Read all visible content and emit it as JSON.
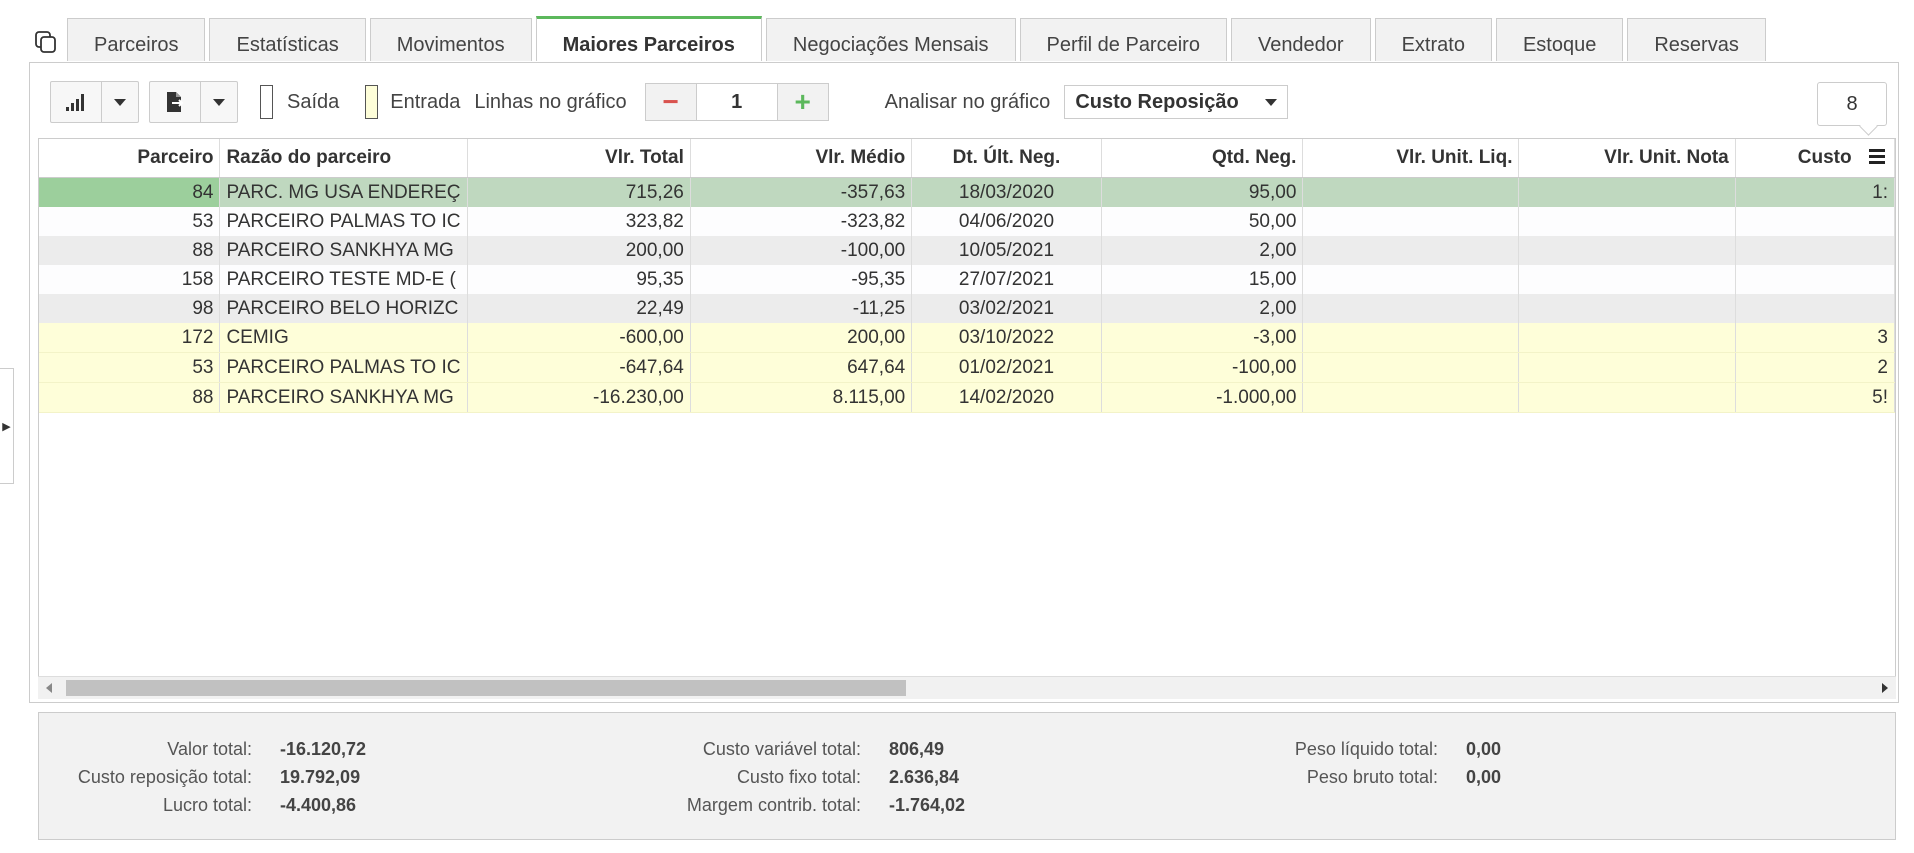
{
  "tabs": [
    "Parceiros",
    "Estatísticas",
    "Movimentos",
    "Maiores Parceiros",
    "Negociações Mensais",
    "Perfil de Parceiro",
    "Vendedor",
    "Extrato",
    "Estoque",
    "Reservas"
  ],
  "active_tab": "Maiores Parceiros",
  "toolbar": {
    "legend_saida": "Saída",
    "legend_entrada": "Entrada",
    "lines_label": "Linhas no gráfico",
    "lines_value": "1",
    "minus": "−",
    "plus": "+",
    "analyze_label": "Analisar no gráfico",
    "analyze_value": "Custo Reposição",
    "record_count": "8"
  },
  "colors": {
    "accent": "#5cb85c",
    "minus": "#d9534f",
    "selected_row": "#bfd8bf",
    "entrada_row": "#fefed9"
  },
  "table": {
    "columns": [
      "Parceiro",
      "Razão do parceiro",
      "Vlr. Total",
      "Vlr. Médio",
      "Dt. Últ. Neg.",
      "Qtd. Neg.",
      "Vlr. Unit. Liq.",
      "Vlr. Unit. Nota",
      "Custo"
    ],
    "rows": [
      {
        "type": "selected",
        "c": [
          "84",
          "PARC. MG USA ENDEREÇ",
          "715,26",
          "-357,63",
          "18/03/2020",
          "95,00",
          "",
          "",
          "1:"
        ]
      },
      {
        "type": "white",
        "c": [
          "53",
          "PARCEIRO PALMAS TO IC",
          "323,82",
          "-323,82",
          "04/06/2020",
          "50,00",
          "",
          "",
          ""
        ]
      },
      {
        "type": "gray",
        "c": [
          "88",
          "PARCEIRO SANKHYA MG",
          "200,00",
          "-100,00",
          "10/05/2021",
          "2,00",
          "",
          "",
          ""
        ]
      },
      {
        "type": "white",
        "c": [
          "158",
          "PARCEIRO TESTE MD-E (",
          "95,35",
          "-95,35",
          "27/07/2021",
          "15,00",
          "",
          "",
          ""
        ]
      },
      {
        "type": "gray",
        "c": [
          "98",
          "PARCEIRO BELO HORIZC",
          "22,49",
          "-11,25",
          "03/02/2021",
          "2,00",
          "",
          "",
          ""
        ]
      },
      {
        "type": "yellow",
        "c": [
          "172",
          "CEMIG",
          "-600,00",
          "200,00",
          "03/10/2022",
          "-3,00",
          "",
          "",
          "3"
        ]
      },
      {
        "type": "yellow",
        "c": [
          "53",
          "PARCEIRO PALMAS TO IC",
          "-647,64",
          "647,64",
          "01/02/2021",
          "-100,00",
          "",
          "",
          "2"
        ]
      },
      {
        "type": "yellow",
        "c": [
          "88",
          "PARCEIRO SANKHYA MG",
          "-16.230,00",
          "8.115,00",
          "14/02/2020",
          "-1.000,00",
          "",
          "",
          "5!"
        ]
      }
    ]
  },
  "totals": {
    "valor_total": {
      "k": "Valor total:",
      "v": "-16.120,72"
    },
    "custo_reposicao_total": {
      "k": "Custo reposição total:",
      "v": "19.792,09"
    },
    "lucro_total": {
      "k": "Lucro total:",
      "v": "-4.400,86"
    },
    "custo_variavel_total": {
      "k": "Custo variável total:",
      "v": "806,49"
    },
    "custo_fixo_total": {
      "k": "Custo fixo total:",
      "v": "2.636,84"
    },
    "margem_contrib_total": {
      "k": "Margem contrib. total:",
      "v": "-1.764,02"
    },
    "peso_liquido_total": {
      "k": "Peso líquido total:",
      "v": "0,00"
    },
    "peso_bruto_total": {
      "k": "Peso bruto total:",
      "v": "0,00"
    }
  }
}
